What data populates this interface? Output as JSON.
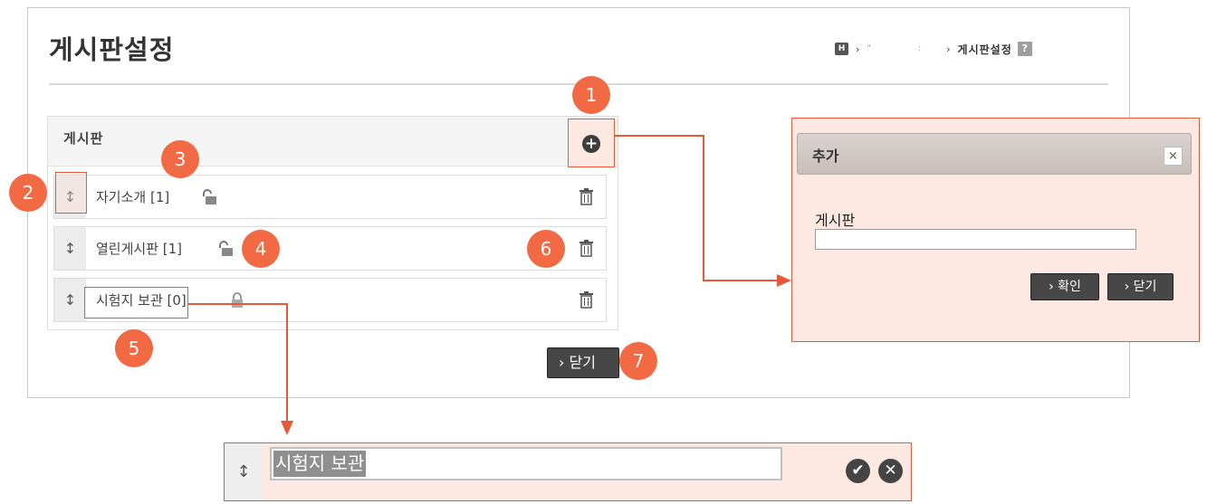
{
  "page": {
    "title": "게시판설정",
    "breadcrumb": {
      "home": "H",
      "sep": "›",
      "faint1": "“",
      "faint2": ":",
      "current": "게시판설정",
      "help": "?"
    }
  },
  "board_list": {
    "header": "게시판",
    "items": [
      {
        "name": "자기소개 [1]"
      },
      {
        "name": "열린게시판 [1]"
      },
      {
        "name": "시험지 보관 [0]"
      }
    ],
    "close_label": "› 닫기"
  },
  "badges": [
    "1",
    "2",
    "3",
    "4",
    "5",
    "6",
    "7"
  ],
  "add_dialog": {
    "title": "추가",
    "close": "×",
    "field_label": "게시판",
    "field_value": "",
    "ok_label": "› 확인",
    "close_label": "› 닫기"
  },
  "edit_row": {
    "value": "시험지 보관"
  },
  "icons": {
    "handle": "↕",
    "add": "+",
    "confirm": "✔",
    "cancel": "✕"
  },
  "colors": {
    "accent": "#f26a43",
    "highlight": "#e8593a",
    "button": "#474747"
  }
}
